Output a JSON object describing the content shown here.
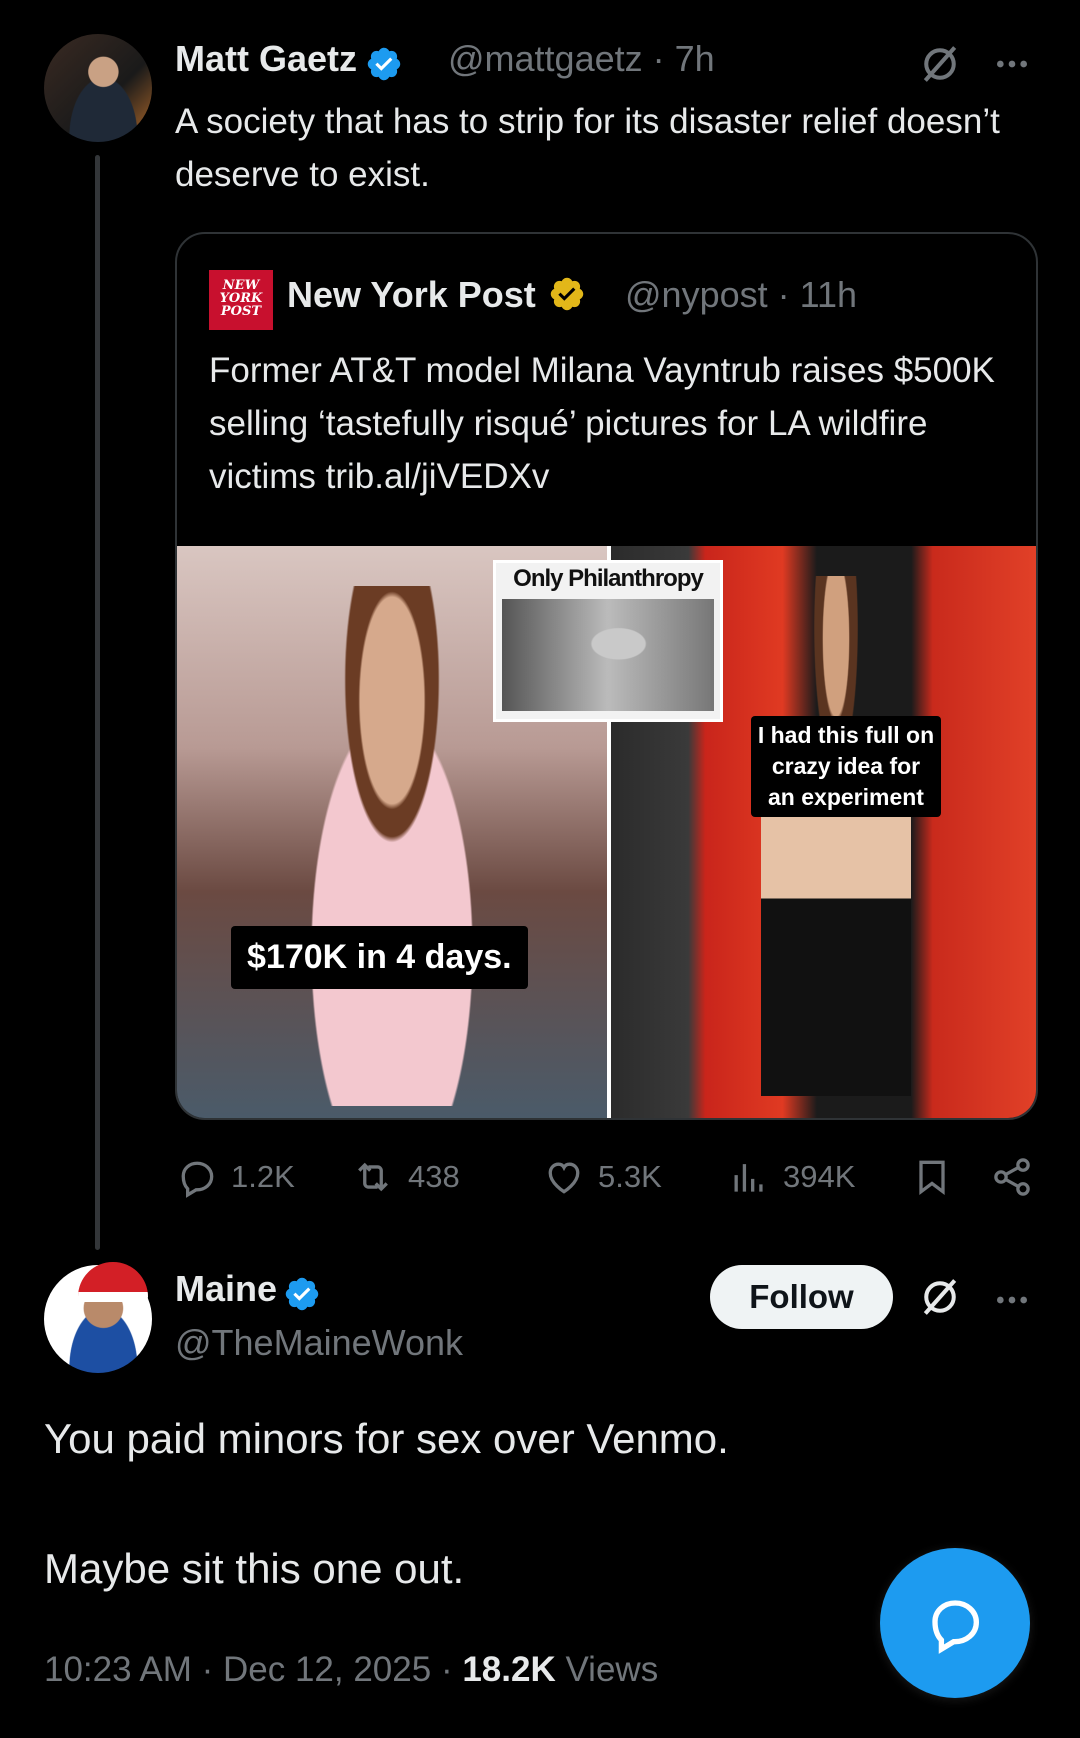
{
  "parent_tweet": {
    "author_name": "Matt Gaetz",
    "handle": "@mattgaetz",
    "time": "7h",
    "text": "A society that has to strip for its disaster relief doesn’t deserve to exist.",
    "quoted": {
      "logo_text": "NEW YORK POST",
      "author_name": "New York Post",
      "handle": "@nypost",
      "time": "11h",
      "text": "Former AT&T model Milana Vayntrub raises $500K selling ‘tastefully risqué’ pictures for LA wildfire victims trib.al/jiVEDXv",
      "image": {
        "inset_title": "Only Philanthropy",
        "caption_left": "$170K in 4 days.",
        "caption_right": "I had this full on crazy idea for an experiment"
      }
    },
    "stats": {
      "replies": "1.2K",
      "reposts": "438",
      "likes": "5.3K",
      "views": "394K"
    }
  },
  "reply": {
    "author_name": "Maine",
    "handle": "@TheMaineWonk",
    "follow_label": "Follow",
    "line1": "You paid minors for sex over Venmo.",
    "line2": "Maybe sit this one out.",
    "time": "10:23 AM",
    "date": "Dec 12, 2025",
    "views_count": "18.2K",
    "views_label": "Views"
  },
  "colors": {
    "background": "#000000",
    "text": "#e7e9ea",
    "muted": "#71767b",
    "verified_blue": "#1d9bf0",
    "verified_gold": "#e2b719",
    "accent": "#1d9bf0"
  },
  "icons": [
    "verified-badge-icon",
    "grok-icon",
    "more-icon",
    "reply-icon",
    "repost-icon",
    "like-icon",
    "views-icon",
    "bookmark-icon",
    "share-icon",
    "compose-reply-icon"
  ]
}
